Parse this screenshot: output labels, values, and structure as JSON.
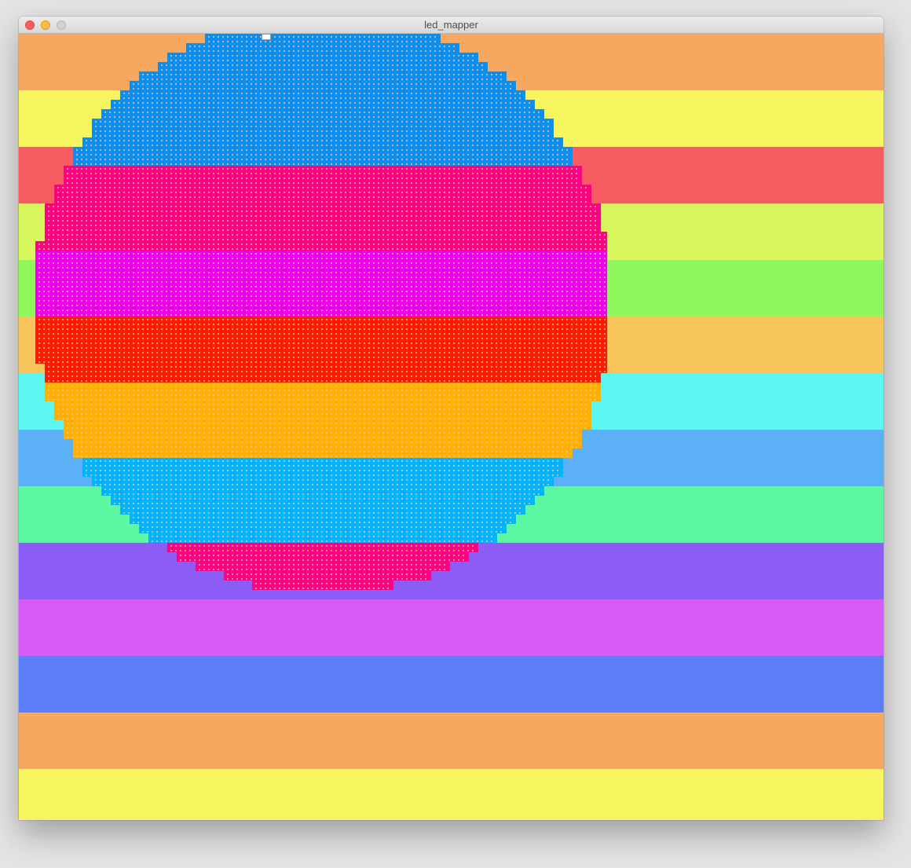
{
  "window": {
    "title": "led_mapper",
    "controls": {
      "close_color": "#fc605c",
      "minimize_color": "#fdbc40",
      "zoom_color": "#d0d0d0"
    }
  },
  "background_stripes": [
    "#f6a860",
    "#f7f55f",
    "#f75c63",
    "#d8f75c",
    "#8ef75c",
    "#f7c55c",
    "#5cf7f0",
    "#5cb0f7",
    "#5cf7a0",
    "#8c5cf7",
    "#d75cf7",
    "#5c7ff7",
    "#f6a860",
    "#f7f55f"
  ],
  "led_matrix": {
    "shape": "circle",
    "dot_color": "#f4c1a4",
    "bands": [
      {
        "color": "#0a8ff0",
        "start": 0.0,
        "end": 0.24
      },
      {
        "color": "#ff0080",
        "start": 0.24,
        "end": 0.385
      },
      {
        "color": "#ee00ee",
        "start": 0.385,
        "end": 0.5
      },
      {
        "color": "#ff1a00",
        "start": 0.5,
        "end": 0.62
      },
      {
        "color": "#ffb000",
        "start": 0.62,
        "end": 0.76
      },
      {
        "color": "#00b4ff",
        "start": 0.76,
        "end": 0.92
      },
      {
        "color": "#ff0080",
        "start": 0.92,
        "end": 1.0
      }
    ]
  },
  "icons": {
    "cursor": "selection-handle-icon"
  }
}
